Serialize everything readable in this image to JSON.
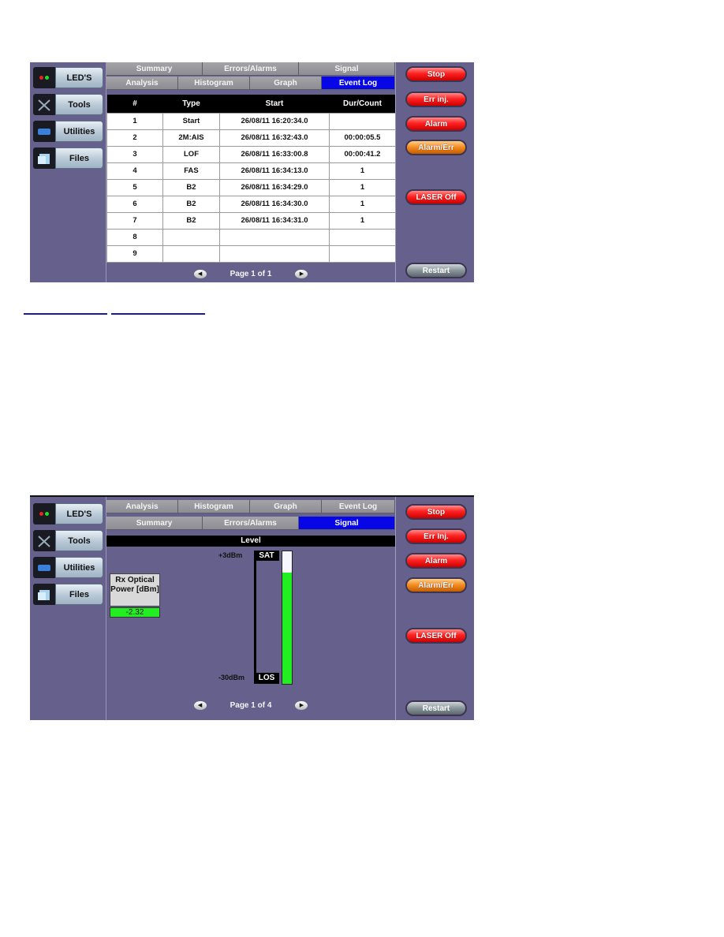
{
  "screen1": {
    "nav": [
      {
        "label": "LED'S",
        "icon": "led-indicator-icon"
      },
      {
        "label": "Tools",
        "icon": "tools-icon"
      },
      {
        "label": "Utilities",
        "icon": "utilities-icon"
      },
      {
        "label": "Files",
        "icon": "files-icon"
      }
    ],
    "tabs_row1": [
      "Summary",
      "Errors/Alarms",
      "Signal"
    ],
    "tabs_row2": [
      "Analysis",
      "Histogram",
      "Graph",
      "Event Log"
    ],
    "active_tab": "Event Log",
    "table": {
      "headers": [
        "#",
        "Type",
        "Start",
        "Dur/Count"
      ],
      "rows": [
        [
          "1",
          "Start",
          "26/08/11 16:20:34.0",
          ""
        ],
        [
          "2",
          "2M:AIS",
          "26/08/11 16:32:43.0",
          "00:00:05.5"
        ],
        [
          "3",
          "LOF",
          "26/08/11 16:33:00.8",
          "00:00:41.2"
        ],
        [
          "4",
          "FAS",
          "26/08/11 16:34:13.0",
          "1"
        ],
        [
          "5",
          "B2",
          "26/08/11 16:34:29.0",
          "1"
        ],
        [
          "6",
          "B2",
          "26/08/11 16:34:30.0",
          "1"
        ],
        [
          "7",
          "B2",
          "26/08/11 16:34:31.0",
          "1"
        ],
        [
          "8",
          "",
          "",
          ""
        ],
        [
          "9",
          "",
          "",
          ""
        ]
      ]
    },
    "pager": {
      "text": "Page 1 of 1",
      "prev": "◀",
      "next": "▶"
    },
    "actions": [
      "Stop",
      "Err inj.",
      "Alarm",
      "Alarm/Err",
      "LASER Off",
      "Restart"
    ]
  },
  "links": [
    "",
    ""
  ],
  "screen2": {
    "nav": [
      {
        "label": "LED'S",
        "icon": "led-indicator-icon"
      },
      {
        "label": "Tools",
        "icon": "tools-icon"
      },
      {
        "label": "Utilities",
        "icon": "utilities-icon"
      },
      {
        "label": "Files",
        "icon": "files-icon"
      }
    ],
    "tabs_row1": [
      "Analysis",
      "Histogram",
      "Graph",
      "Event Log"
    ],
    "tabs_row2": [
      "Summary",
      "Errors/Alarms",
      "Signal"
    ],
    "active_tab": "Signal",
    "section_title": "Level",
    "rx_label": "Rx Optical Power [dBm]",
    "rx_value": "-2.32",
    "scale_top": "+3dBm",
    "scale_bottom": "-30dBm",
    "sat_label": "SAT",
    "los_label": "LOS",
    "meter": {
      "min_dbm": -30,
      "max_dbm": 3,
      "value_dbm": -2.32
    },
    "pager": {
      "text": "Page 1 of 4",
      "prev": "◀",
      "next": "▶"
    },
    "actions": [
      "Stop",
      "Err Inj.",
      "Alarm",
      "Alarm/Err",
      "LASER Off",
      "Restart"
    ]
  },
  "colors": {
    "panel_bg": "#66608c",
    "active_tab": "#0606e6",
    "meter_green": "#22ee22",
    "alarm_red": "#ee2222",
    "alarm_orange": "#f38a1c"
  }
}
